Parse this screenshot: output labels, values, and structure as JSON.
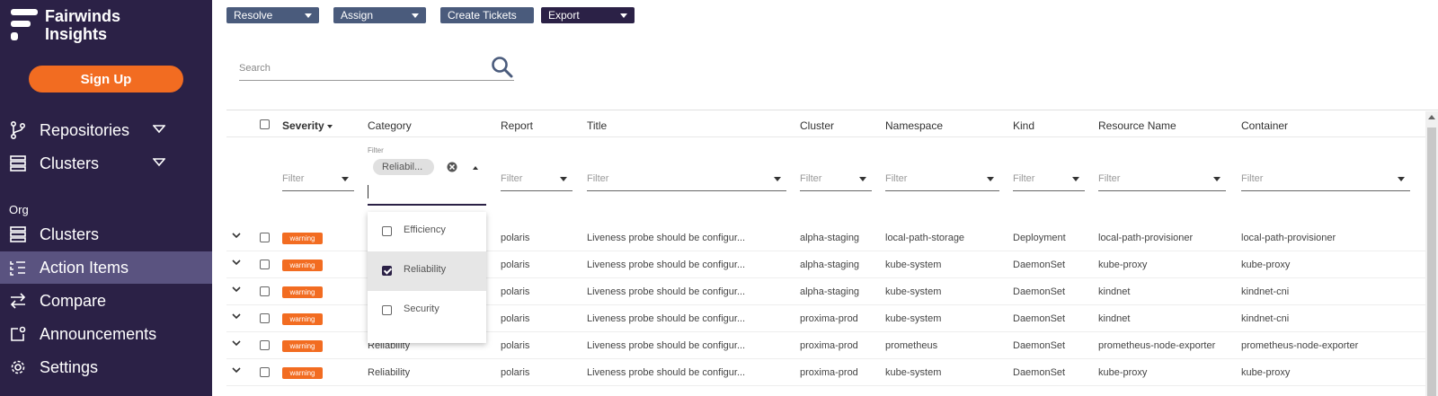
{
  "app": {
    "name_line1": "Fairwinds",
    "name_line2": "Insights"
  },
  "sidebar": {
    "signup_label": "Sign Up",
    "items": [
      {
        "label": "Repositories",
        "icon": "git-branch-icon"
      },
      {
        "label": "Clusters",
        "icon": "server-stack-icon"
      }
    ],
    "org_label": "Org",
    "org_items": [
      {
        "label": "Clusters",
        "icon": "server-stack-icon"
      },
      {
        "label": "Action Items",
        "icon": "list-icon",
        "active": true
      },
      {
        "label": "Compare",
        "icon": "arrows-exchange-icon"
      },
      {
        "label": "Announcements",
        "icon": "external-square-icon"
      },
      {
        "label": "Settings",
        "icon": "gear-icon"
      }
    ]
  },
  "toolbar": {
    "resolve": "Resolve",
    "assign": "Assign",
    "create_tickets": "Create Tickets",
    "export": "Export"
  },
  "search": {
    "placeholder": "Search"
  },
  "table": {
    "headers": {
      "severity": "Severity",
      "category": "Category",
      "report": "Report",
      "title": "Title",
      "cluster": "Cluster",
      "namespace": "Namespace",
      "kind": "Kind",
      "resource_name": "Resource Name",
      "container": "Container"
    },
    "filter_placeholder": "Filter",
    "category_filter": {
      "caption": "Filter",
      "chip": "Reliabil...",
      "options": [
        {
          "label": "Efficiency",
          "checked": false
        },
        {
          "label": "Reliability",
          "checked": true
        },
        {
          "label": "Security",
          "checked": false
        }
      ]
    },
    "rows": [
      {
        "severity": "warning",
        "category": "",
        "report": "polaris",
        "title": "Liveness probe should be configur...",
        "cluster": "alpha-staging",
        "namespace": "local-path-storage",
        "kind": "Deployment",
        "resource_name": "local-path-provisioner",
        "container": "local-path-provisioner"
      },
      {
        "severity": "warning",
        "category": "",
        "report": "polaris",
        "title": "Liveness probe should be configur...",
        "cluster": "alpha-staging",
        "namespace": "kube-system",
        "kind": "DaemonSet",
        "resource_name": "kube-proxy",
        "container": "kube-proxy"
      },
      {
        "severity": "warning",
        "category": "",
        "report": "polaris",
        "title": "Liveness probe should be configur...",
        "cluster": "alpha-staging",
        "namespace": "kube-system",
        "kind": "DaemonSet",
        "resource_name": "kindnet",
        "container": "kindnet-cni"
      },
      {
        "severity": "warning",
        "category": "",
        "report": "polaris",
        "title": "Liveness probe should be configur...",
        "cluster": "proxima-prod",
        "namespace": "kube-system",
        "kind": "DaemonSet",
        "resource_name": "kindnet",
        "container": "kindnet-cni"
      },
      {
        "severity": "warning",
        "category": "Reliability",
        "report": "polaris",
        "title": "Liveness probe should be configur...",
        "cluster": "proxima-prod",
        "namespace": "prometheus",
        "kind": "DaemonSet",
        "resource_name": "prometheus-node-exporter",
        "container": "prometheus-node-exporter"
      },
      {
        "severity": "warning",
        "category": "Reliability",
        "report": "polaris",
        "title": "Liveness probe should be configur...",
        "cluster": "proxima-prod",
        "namespace": "kube-system",
        "kind": "DaemonSet",
        "resource_name": "kube-proxy",
        "container": "kube-proxy"
      }
    ]
  },
  "colors": {
    "sidebar_bg": "#2b2146",
    "accent_orange": "#f26c21",
    "active_nav": "#5a5380",
    "button_blue": "#4a5b7c"
  }
}
